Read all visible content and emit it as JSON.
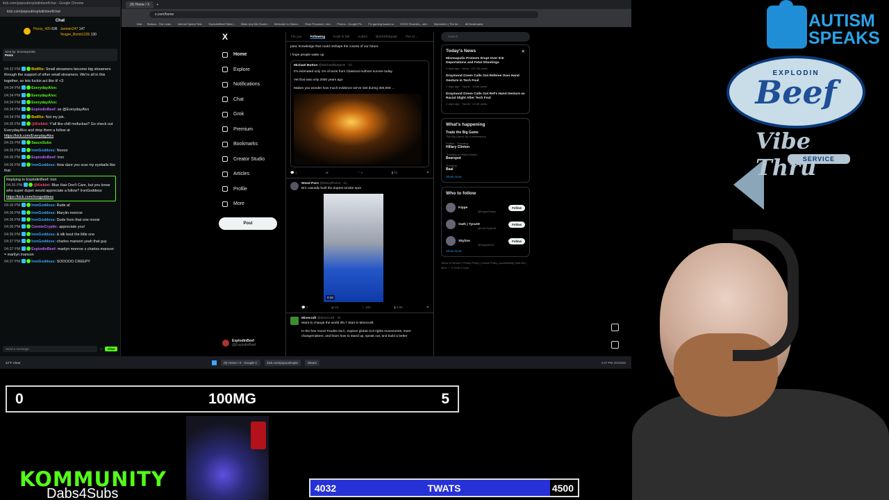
{
  "chat_window": {
    "title": "kick.com/popout/explodinbeef/chat - Google Chrome",
    "url": "kick.com/popout/explodinbeef/chat",
    "header": "Chat",
    "leaders": [
      {
        "name": "Pezzy_420",
        "count": "636"
      },
      {
        "name": "Jammin247",
        "count": "147"
      },
      {
        "name": "Yeager_Bomb1226",
        "count": "130"
      }
    ],
    "pinned_by": "Sent by: bmoney2456",
    "pinned_text": "Penis",
    "messages": [
      {
        "time": "04:32 PM",
        "user": "BotRix:",
        "user_color": "yellow",
        "text": "Small streamers become big streamers through the support of other small streamers. We're all in this together, so lets fuckin act like it! <3"
      },
      {
        "time": "04:34 PM",
        "user": "EverydayAlvx:",
        "user_color": "green",
        "text": ""
      },
      {
        "time": "04:34 PM",
        "user": "EverydayAlvx:",
        "user_color": "green",
        "text": ""
      },
      {
        "time": "04:34 PM",
        "user": "EverydayAlvx:",
        "user_color": "green",
        "text": ""
      },
      {
        "time": "04:34 PM",
        "user": "ExplodinBeef:",
        "user_color": "purple",
        "text": "so @EverydayAlvx"
      },
      {
        "time": "04:34 PM",
        "user": "BotRix:",
        "user_color": "yellow",
        "text": "Not my job."
      },
      {
        "time": "04:35 PM",
        "user": "@Kicklet:",
        "user_color": "red",
        "text": "Y'all like chill mofuckas? Go check out EverydayAlvx and drop them a follow at",
        "link": "https://kick.com/EverydayAlvx"
      },
      {
        "time": "04:35 PM",
        "user": "SauceSubs",
        "user_color": "green",
        "text": ""
      },
      {
        "time": "04:36 PM",
        "user": "IronGoddess:",
        "user_color": "blue",
        "text": "Noooo"
      },
      {
        "time": "04:36 PM",
        "user": "ExplodinBeef:",
        "user_color": "purple",
        "text": "Iron"
      },
      {
        "time": "04:36 PM",
        "user": "IronGoddess:",
        "user_color": "blue",
        "text": "How dare you scar my eyeballs like that"
      },
      {
        "time": "04:36 PM",
        "user": "@Kicklet:",
        "user_color": "red",
        "text": "Blue Hair Don't Care, but you know who super duper would appreciate a follow? IronGoddess",
        "link": "https://kick.com/irongoddess",
        "reply": "Replying to ExplodinBeef: Iron",
        "highlight": true
      },
      {
        "time": "04:36 PM",
        "user": "IronGoddess:",
        "user_color": "blue",
        "text": "Rude af"
      },
      {
        "time": "04:36 PM",
        "user": "IronGoddess:",
        "user_color": "blue",
        "text": "Marylin monroe"
      },
      {
        "time": "04:36 PM",
        "user": "IronGoddess:",
        "user_color": "blue",
        "text": "Dude from that one movie"
      },
      {
        "time": "04:36 PM",
        "user": "ConnieCryptic:",
        "user_color": "purple",
        "text": "appreciate you!"
      },
      {
        "time": "04:36 PM",
        "user": "IronGoddess:",
        "user_color": "blue",
        "text": "& idk bout the little one"
      },
      {
        "time": "04:37 PM",
        "user": "IronGoddess:",
        "user_color": "blue",
        "text": "charles manson yeah that guy"
      },
      {
        "time": "04:37 PM",
        "user": "ExplodinBeef:",
        "user_color": "purple",
        "text": "marilyn monroe x charles manson = marilyn manson"
      },
      {
        "time": "04:37 PM",
        "user": "IronGoddess:",
        "user_color": "blue",
        "text": "SOOOOO CREEPY"
      }
    ],
    "input_placeholder": "Send a message",
    "send_label": "Chat"
  },
  "browser": {
    "tab_title": "(9) Home / X",
    "url": "x.com/home",
    "bookmarks": [
      "Kick",
      "Statsus - The Lead...",
      "Internet Speed Test...",
      "ExplodinBeef Stats |...",
      "Make Any Mic Sound...",
      "Welcome to Okdoo...",
      "Rose Porpoise | clot...",
      "Photos - Google Ph...",
      "Fix gaming issues w...",
      "KSOX Roomies - see...",
      "Mymoterm | The be...",
      "All Bookmarks"
    ]
  },
  "x_nav": {
    "logo": "X",
    "items": [
      "Home",
      "Explore",
      "Notifications",
      "Chat",
      "Grok",
      "Premium",
      "Bookmarks",
      "Creator Studio",
      "Articles",
      "Profile",
      "More"
    ],
    "post_label": "Post",
    "profile_name": "ExplodinBeef",
    "profile_handle": "@ExplodinBeef"
  },
  "feed": {
    "tabs": [
      "For you",
      "Following",
      "Kush N Tell",
      "Autism",
      "BotchPitSquad",
      "The Cr..."
    ],
    "top_text_1": "past, knowledge that could reshape the course of our future.",
    "top_text_2": "I hope people wake up.",
    "quote_name": "Michael Button",
    "quote_handle": "@MichaelButtonX · 1h",
    "quote_text_1": "It's estimated only 1% of texts from Classical Authors survive today",
    "quote_text_2": "Yet that was only 2000 years ago",
    "quote_text_3": "Makes you wonder how much evidence we've lost during 300,000 ...",
    "post1_actions": [
      "1",
      "",
      "4",
      "22",
      ""
    ],
    "post2_name": "Weed Porn",
    "post2_handle": "@WeedPorns · 1h",
    "post2_text": "Bro casually built the dopest smoke spot",
    "post2_video_duration": "0:19",
    "post2_actions": [
      "2",
      "10",
      "102",
      "5.8K",
      ""
    ],
    "post3_name": "Minecraft",
    "post3_handle": "@Minecraft · 4h",
    "post3_text_1": "Want to change the world IRL? Start in Minecraft.",
    "post3_text_2": "In the free Good Trouble DLC, explore global civil rights movements, meet changemakers, and learn how to stand up, speak out, and build a better"
  },
  "right_col": {
    "search_placeholder": "Search",
    "news_title": "Today's News",
    "news": [
      {
        "title": "Minneapolis Protests Erupt Over ICE Deportations and Fetal Shootings",
        "meta": "3 days ago · News · 197.5K posts"
      },
      {
        "title": "Draymond Green Calls Out Referee Over Hand Gesture in Tech Foul",
        "meta": "2 days ago · Sports · 34.6K posts"
      },
      {
        "title": "Draymond Green Calls Out Ref's Hand Gesture as Racial Slight After Tech Foul",
        "meta": "2 days ago · Sports · 23.4K posts"
      }
    ],
    "happening_title": "What's happening",
    "trends": [
      {
        "context": "",
        "title": "Trade the Big Game",
        "sub": "The Big Game: $0 Commissions"
      },
      {
        "context": "Politics · Trending",
        "title": "Hillary Clinton",
        "sub": ""
      },
      {
        "context": "Trending in United States",
        "title": "Bearspot",
        "sub": ""
      },
      {
        "context": "Trending",
        "title": "Baal",
        "sub": ""
      }
    ],
    "show_more": "Show more",
    "who_title": "Who to follow",
    "who": [
      {
        "name": "Kippe",
        "handle": "@KippeGrows",
        "button": "Follow"
      },
      {
        "name": "Oath | Tyrantt",
        "handle": "@LArnTyrantX",
        "button": "Follow"
      },
      {
        "name": "Skyline",
        "handle": "@SkylineOG",
        "button": "Follow"
      }
    ],
    "footer": "Terms of Service | Privacy Policy | Cookie Policy | Accessibility | Ads info | More ··· © 2026 X Corp."
  },
  "taskbar": {
    "weather": "42°F Clear",
    "apps": [
      "(9) Home / X - Google C",
      "kick.com/popout/explo",
      "Steam"
    ],
    "clock": "4:37 PM 2/2/2026"
  },
  "overlays": {
    "counter_left": "0",
    "counter_mid": "100MG",
    "counter_right": "5",
    "community_top": "KOMMUNITY",
    "community_sub": "Dabs4Subs",
    "progress_current": "4032",
    "progress_label": "TWATS",
    "progress_goal": "4500",
    "progress_fraction": 0.896,
    "autism_text_1": "AUTISM",
    "autism_text_2": "SPEAKS",
    "sign_top": "EXPLODIN",
    "sign_big": "Beef",
    "sign_vibe": "Vibe Thru",
    "sign_service": "SERVICE"
  },
  "colors": {
    "kick_green": "#53fc18",
    "x_blue": "#1d9bf0",
    "progress_fill": "#2631d8"
  }
}
